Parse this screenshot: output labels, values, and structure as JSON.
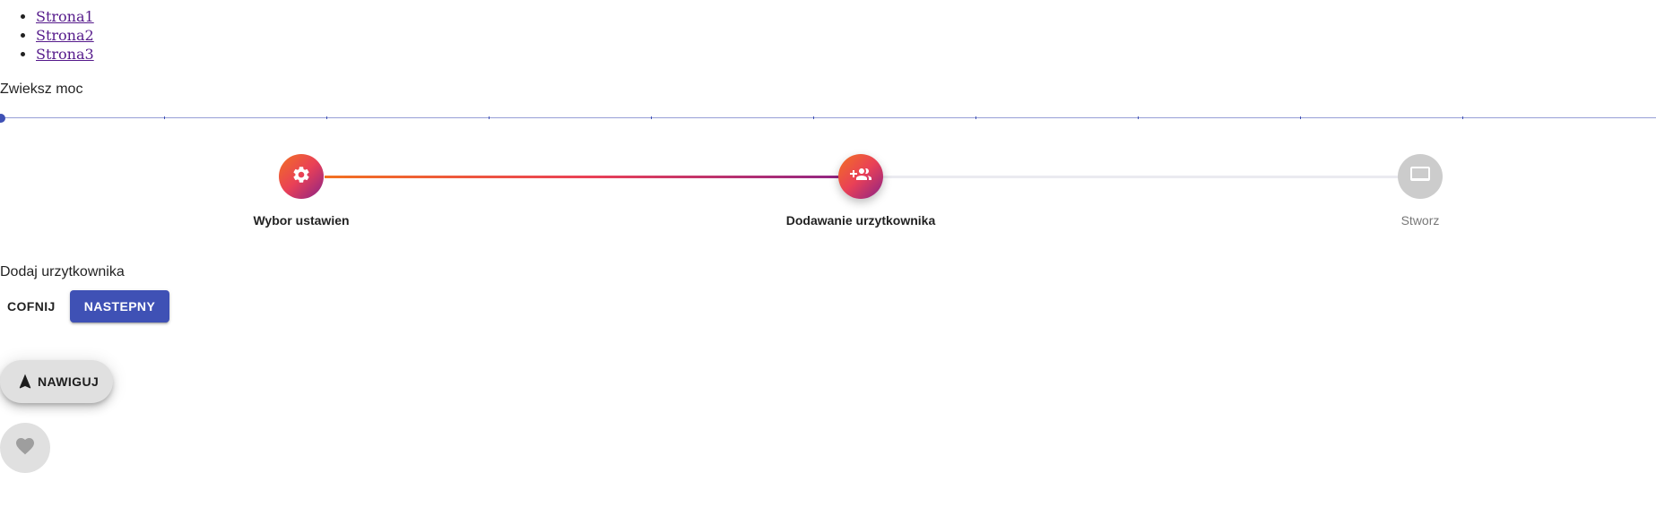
{
  "nav": {
    "links": [
      "Strona1",
      "Strona2",
      "Strona3"
    ]
  },
  "slider": {
    "label": "Zwieksz moc",
    "value": 0,
    "min": 0,
    "max": 100,
    "step": 10,
    "color": "#3f51b5"
  },
  "stepper": {
    "active_step": 1,
    "steps": [
      {
        "label": "Wybor ustawien",
        "icon": "settings-icon",
        "state": "completed"
      },
      {
        "label": "Dodawanie urzytkownika",
        "icon": "group-add-icon",
        "state": "active"
      },
      {
        "label": "Stworz",
        "icon": "video-label-icon",
        "state": "inactive"
      }
    ],
    "gradient_colors": [
      "#f27121",
      "#e94057",
      "#8a2387"
    ],
    "inactive_color": "#cccccc"
  },
  "content": {
    "text": "Dodaj urzytkownika"
  },
  "actions": {
    "back_label": "COFNIJ",
    "next_label": "NASTEPNY",
    "primary_color": "#3f51b5"
  },
  "fab": {
    "navigate_label": "NAWIGUJ",
    "navigate_icon": "navigation-icon",
    "favorite_icon": "heart-icon"
  }
}
